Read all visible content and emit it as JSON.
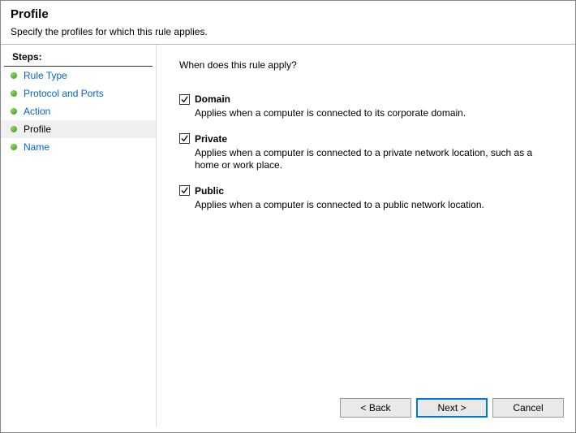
{
  "header": {
    "title": "Profile",
    "subtitle": "Specify the profiles for which this rule applies."
  },
  "sidebar": {
    "title": "Steps:",
    "items": [
      {
        "label": "Rule Type",
        "current": false
      },
      {
        "label": "Protocol and Ports",
        "current": false
      },
      {
        "label": "Action",
        "current": false
      },
      {
        "label": "Profile",
        "current": true
      },
      {
        "label": "Name",
        "current": false
      }
    ]
  },
  "main": {
    "question": "When does this rule apply?",
    "options": [
      {
        "key": "domain",
        "label": "Domain",
        "checked": true,
        "desc": "Applies when a computer is connected to its corporate domain."
      },
      {
        "key": "private",
        "label": "Private",
        "checked": true,
        "desc": "Applies when a computer is connected to a private network location, such as a home or work place."
      },
      {
        "key": "public",
        "label": "Public",
        "checked": true,
        "desc": "Applies when a computer is connected to a public network location."
      }
    ]
  },
  "buttons": {
    "back": "< Back",
    "next": "Next >",
    "cancel": "Cancel"
  }
}
